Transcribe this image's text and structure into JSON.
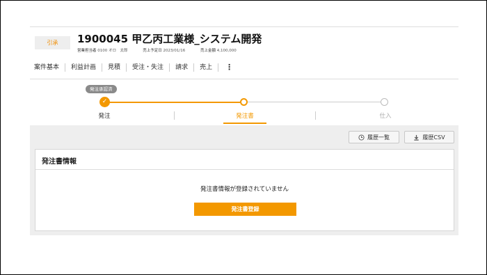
{
  "header": {
    "status_badge": "引承",
    "title": "1900045 甲乙丙工業様_システム開発",
    "meta": [
      {
        "label": "営業担当者",
        "value": "0100 オロ　太郎"
      },
      {
        "label": "売上予定日",
        "value": "2023/01/16"
      },
      {
        "label": "売上金額",
        "value": "4,100,000"
      }
    ]
  },
  "tabs": [
    "案件基本",
    "利益計画",
    "見積",
    "受注・失注",
    "請求",
    "売上"
  ],
  "more_menu": "⋮",
  "steps": {
    "pill": "発注承認済",
    "items": [
      {
        "label": "発注",
        "state": "done",
        "mark": "✓"
      },
      {
        "label": "発注書",
        "state": "current"
      },
      {
        "label": "仕入",
        "state": "todo"
      }
    ]
  },
  "toolbar": {
    "history_label": "履歴一覧",
    "csv_label": "履歴CSV"
  },
  "card": {
    "title": "発注書情報",
    "empty_message": "発注書情報が登録されていません",
    "register_label": "発注書登録"
  },
  "colors": {
    "accent": "#f39800",
    "panel_bg": "#eeeeee",
    "pill_bg": "#8a8a8a"
  }
}
